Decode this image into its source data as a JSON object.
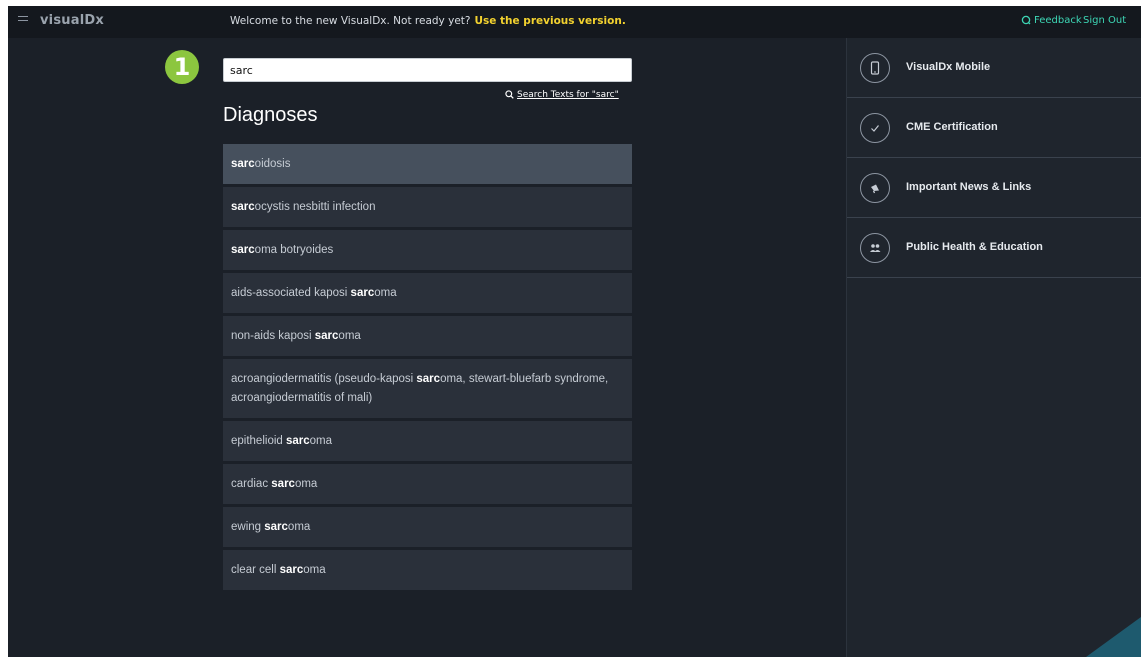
{
  "header": {
    "logo": "visualDx",
    "welcome_text": "Welcome to the new VisualDx. Not ready yet?",
    "previous_version_link": "Use the previous version.",
    "feedback_label": "Feedback",
    "signout_label": "Sign Out"
  },
  "step_badge": "1",
  "search": {
    "value": "sarc",
    "search_texts_label": "Search Texts for \"sarc\""
  },
  "section_title": "Diagnoses",
  "results": [
    {
      "parts": [
        "",
        "sarc",
        "oidosis"
      ],
      "selected": true
    },
    {
      "parts": [
        "",
        "sarc",
        "ocystis nesbitti infection"
      ]
    },
    {
      "parts": [
        "",
        "sarc",
        "oma botryoides"
      ]
    },
    {
      "parts": [
        "aids-associated kaposi ",
        "sarc",
        "oma"
      ]
    },
    {
      "parts": [
        "non-aids kaposi ",
        "sarc",
        "oma"
      ]
    },
    {
      "parts": [
        "acroangiodermatitis (pseudo-kaposi ",
        "sarc",
        "oma, stewart-bluefarb syndrome, acroangiodermatitis of mali)"
      ]
    },
    {
      "parts": [
        "epithelioid ",
        "sarc",
        "oma"
      ]
    },
    {
      "parts": [
        "cardiac ",
        "sarc",
        "oma"
      ]
    },
    {
      "parts": [
        "ewing ",
        "sarc",
        "oma"
      ]
    },
    {
      "parts": [
        "clear cell ",
        "sarc",
        "oma"
      ]
    }
  ],
  "sidebar": {
    "items": [
      {
        "label": "VisualDx Mobile",
        "icon": "mobile-phone-icon"
      },
      {
        "label": "CME Certification",
        "icon": "checkmark-icon"
      },
      {
        "label": "Important News & Links",
        "icon": "megaphone-icon"
      },
      {
        "label": "Public Health & Education",
        "icon": "people-icon"
      }
    ]
  },
  "colors": {
    "accent_link": "#3dd6b5",
    "highlight_link": "#f3d22f",
    "badge": "#8cc63f",
    "background": "#1b2028"
  }
}
